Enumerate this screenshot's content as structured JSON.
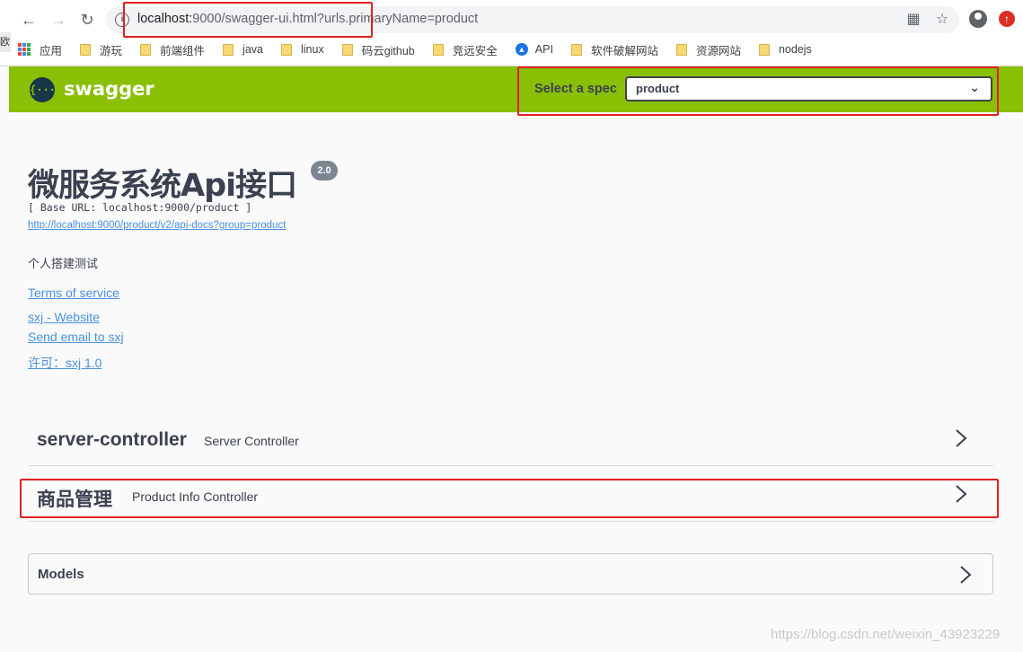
{
  "browser": {
    "url_host": "localhost:",
    "url_rest": "9000/swagger-ui.html?urls.primaryName=product",
    "edge_text": "欧",
    "bookmarks": [
      {
        "label": "应用",
        "icon": "apps-grid-icon"
      },
      {
        "label": "游玩",
        "icon": "folder-icon"
      },
      {
        "label": "前端组件",
        "icon": "folder-icon"
      },
      {
        "label": "java",
        "icon": "folder-icon"
      },
      {
        "label": "linux",
        "icon": "folder-icon"
      },
      {
        "label": "码云github",
        "icon": "folder-icon"
      },
      {
        "label": "竞远安全",
        "icon": "folder-icon"
      },
      {
        "label": "API",
        "icon": "api-icon"
      },
      {
        "label": "软件破解网站",
        "icon": "folder-icon"
      },
      {
        "label": "资源网站",
        "icon": "folder-icon"
      },
      {
        "label": "nodejs",
        "icon": "folder-icon"
      }
    ]
  },
  "swagger": {
    "logo_text": "swagger",
    "logo_symbol": "{···}",
    "spec_label": "Select a spec",
    "spec_value": "product",
    "brand_color": "#89bf04"
  },
  "info": {
    "title": "微服务系统Api接口",
    "version": "2.0",
    "base_url": "[ Base URL: localhost:9000/product ]",
    "docs_url": "http://localhost:9000/product/v2/api-docs?group=product",
    "description": "个人搭建测试",
    "terms": "Terms of service",
    "website": "sxj - Website",
    "email": "Send email to sxj",
    "license": "许可：sxj 1.0"
  },
  "tags": [
    {
      "name": "server-controller",
      "description": "Server Controller"
    },
    {
      "name": "商品管理",
      "description": "Product Info Controller"
    }
  ],
  "models": {
    "label": "Models"
  },
  "watermark": "https://blog.csdn.net/weixin_43923229"
}
